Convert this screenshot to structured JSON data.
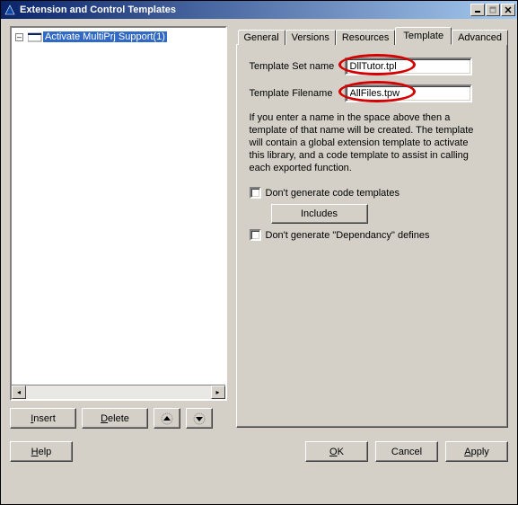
{
  "window": {
    "title": "Extension and Control Templates"
  },
  "tree": {
    "item_label": "Activate MultiPrj Support(1)"
  },
  "left_buttons": {
    "insert": "Insert",
    "delete": "Delete"
  },
  "tabs": {
    "general": "General",
    "versions": "Versions",
    "resources": "Resources",
    "template": "Template",
    "advanced": "Advanced"
  },
  "form": {
    "set_name_label": "Template Set name",
    "set_name_value": "DllTutor.tpl",
    "filename_label": "Template Filename",
    "filename_value": "AllFiles.tpw",
    "description": "If you enter a name in the space above then a template of that name will be created. The template will contain a global extension template to activate this library, and a code template to assist in calling each exported function.",
    "dont_gen_code": "Don't generate code templates",
    "includes": "Includes",
    "dont_gen_dep": "Don't generate \"Dependancy\" defines"
  },
  "footer": {
    "help": "Help",
    "ok": "OK",
    "cancel": "Cancel",
    "apply": "Apply"
  }
}
